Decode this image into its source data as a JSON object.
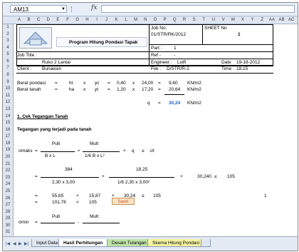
{
  "formula_bar": {
    "name_box": "AM13",
    "fx_label": "fx",
    "formula": ""
  },
  "columns": [
    "A",
    "B",
    "C",
    "D",
    "E",
    "F",
    "G",
    "H",
    "I",
    "J",
    "K",
    "L",
    "M",
    "N",
    "O",
    "P",
    "Q",
    "R",
    "S",
    "T",
    "U",
    "V",
    "W",
    "X",
    "Y",
    "Z",
    "AA",
    "AB",
    "AC"
  ],
  "rows": [
    "1",
    "2",
    "3",
    "4",
    "5",
    "6",
    "7",
    "8",
    "9",
    "10",
    "11",
    "12",
    "13",
    "14",
    "15",
    "16",
    "17",
    "18",
    "19",
    "20",
    "21",
    "22",
    "23",
    "24",
    "25",
    "26",
    "27",
    "28",
    "29",
    "30",
    "31"
  ],
  "header": {
    "program_title": "Program Hitung Pondasi Tapak",
    "job_no_label": "Job No.",
    "job_no_value": "01/STR/RK/2012",
    "sheet_no_label": "SHEET No",
    "sheet_no_value": "1",
    "part_label": "Part :",
    "part_value": "1",
    "ref_label": "Ref -",
    "ref_value": "-",
    "job_title_label": "Job Title :",
    "job_title_value": "Ruko 2 Lantai",
    "engineer_label": "Engineer :",
    "engineer_value": "Lutfi",
    "date_label": "Date",
    "date_value": "19-18-2012",
    "client_label": "Client :",
    "client_value": "Bunawan",
    "file_label": "File :",
    "file_value": "D/STR/R-2",
    "time_label": "Time :",
    "time_value": "18.15"
  },
  "loads": {
    "row1": {
      "label": "Berat pondasi",
      "eq": "=",
      "a": "ht",
      "x1": "x",
      "b": "yc",
      "eq2": "=",
      "c": "0,40",
      "x2": "x",
      "d": "24,00",
      "eq3": "=",
      "e": "9,60",
      "unit": "KN/m2"
    },
    "row2": {
      "label": "Berat tanah",
      "eq": "=",
      "a": "ha",
      "x1": "x",
      "b": "yt",
      "eq2": "=",
      "c": "1,20",
      "x2": "x",
      "d": "17,20",
      "eq3": "=",
      "e": "20,64",
      "unit": "KN/m2"
    },
    "q_label": "q",
    "q_eq": "=",
    "q_value": "30,24",
    "q_unit": "KN/m2"
  },
  "section1": {
    "title": "1. Cek Tegangan Tanah",
    "subtitle": "Tegangan yang terjadi pada tanah",
    "smax": "σmaks",
    "eq": "=",
    "pult": "Pult",
    "mult": "Mult",
    "plus": "+",
    "q": "q",
    "le": "≤",
    "sigma_t": "σt",
    "den1": "B  x  L",
    "den2": "1/6  B  x  L²",
    "val_pult": "384",
    "val_mult": "18,25",
    "den_val1": "2,30  x  3,00",
    "den_val2": "1/6   2,30  x  3,00²",
    "res1_q": "30,240",
    "res1_le": "≤",
    "res1_st": "105",
    "r26_a": "55,65",
    "r26_b": "15,87",
    "r26_c": "30,24",
    "r26_st": "105",
    "r26_flag": "1",
    "r27_a": "101,76",
    "r27_lt": "<",
    "r27_st": "105",
    "save_label": "Save!",
    "smin": "σmin"
  },
  "tabs": [
    "Input Data",
    "Hasil Perhitungan",
    "Desain Tulangan",
    "Skema Hitung Pondasi"
  ],
  "active_tab": "Hasil Perhitungan"
}
